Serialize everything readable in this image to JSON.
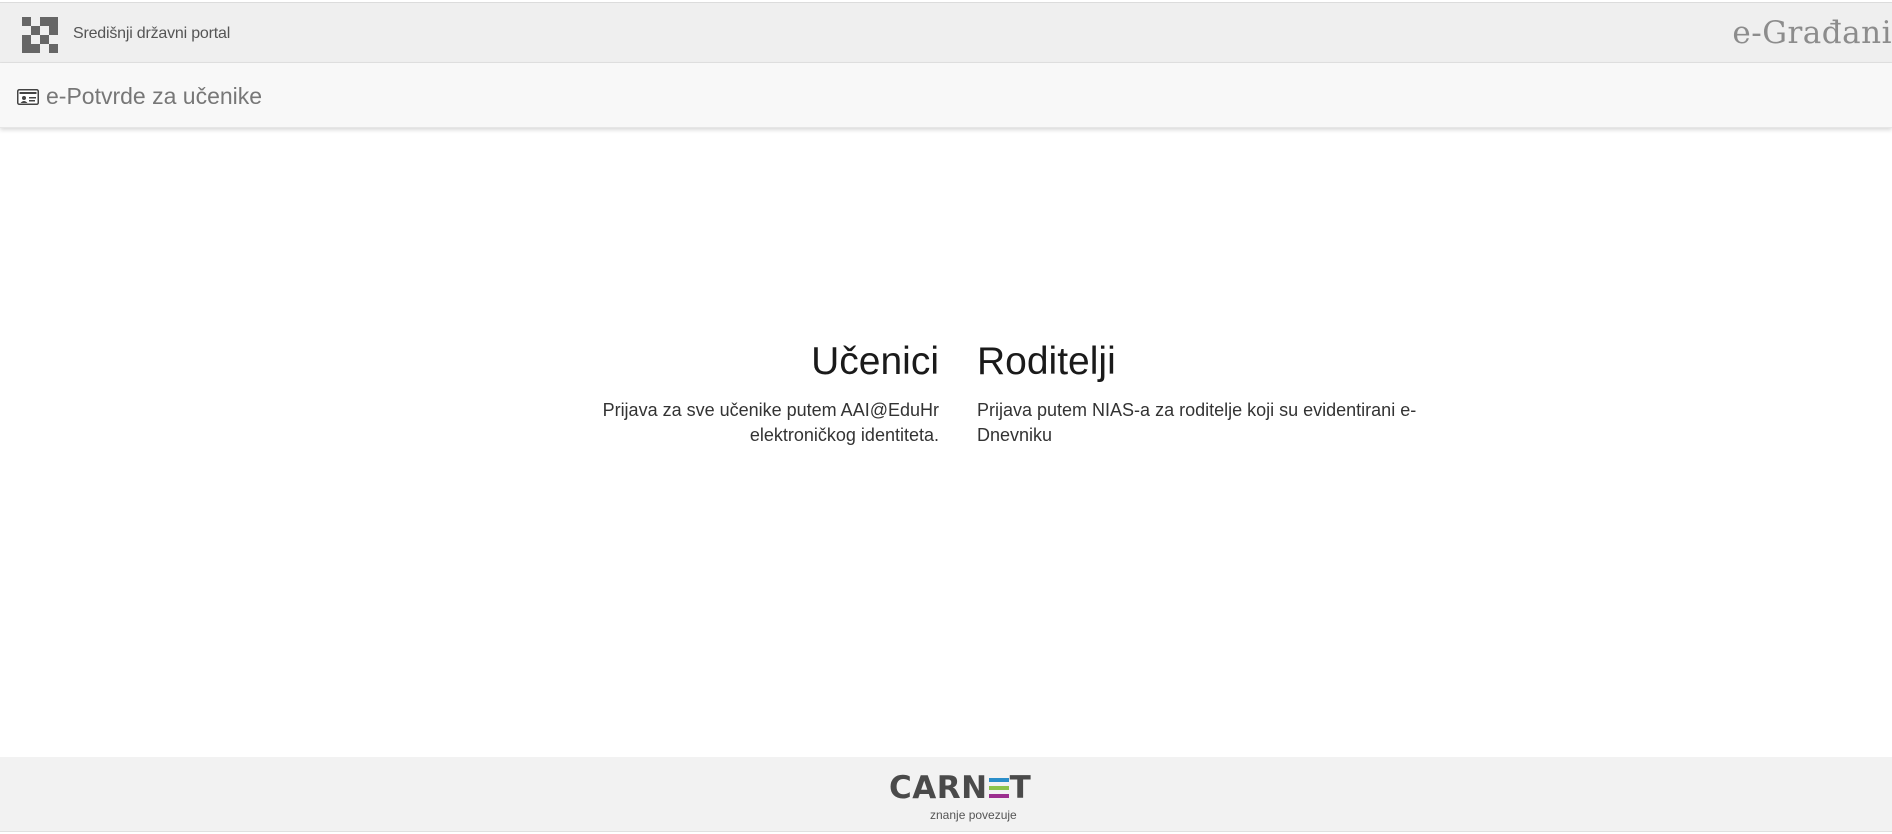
{
  "gov_bar": {
    "title": "Središnji državni portal",
    "brand": "e-Građani"
  },
  "app_bar": {
    "title": "e-Potvrde za učenike",
    "icon": "id-card-icon"
  },
  "options": [
    {
      "heading": "Učenici",
      "description": "Prijava za sve učenike putem AAI@EduHr elektroničkog identiteta."
    },
    {
      "heading": "Roditelji",
      "description": "Prijava putem NIAS-a za roditelje koji su evidentirani e-Dnevniku"
    }
  ],
  "footer": {
    "logo_prefix": "CARN",
    "logo_suffix": "T",
    "tagline": "znanje povezuje",
    "logo_colors": [
      "#2a8ec9",
      "#8bc34a",
      "#9c2f8f"
    ]
  },
  "colors": {
    "gov_bar_bg": "#efefef",
    "app_bar_bg": "#f8f8f8",
    "footer_bg": "#f2f2f2",
    "text_dark": "#1a1a1a",
    "text_muted": "#777777"
  }
}
